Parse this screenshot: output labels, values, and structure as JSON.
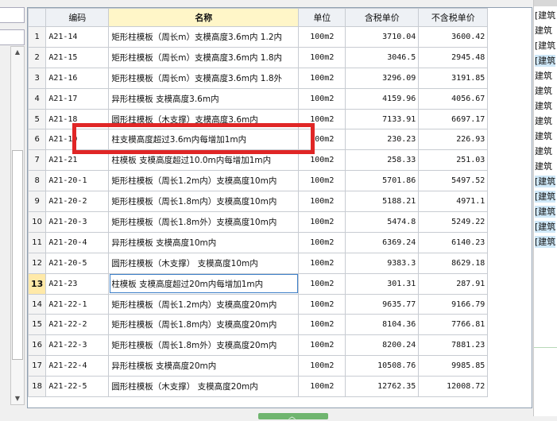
{
  "columns": {
    "index": "",
    "code": "编码",
    "name": "名称",
    "unit": "单位",
    "price_tax": "含税单价",
    "price_notax": "不含税单价"
  },
  "rows": [
    {
      "no": "1",
      "code": "A21-14",
      "name": "矩形柱模板（周长m）支模高度3.6m内 1.2内",
      "unit": "100m2",
      "tax": "3710.04",
      "notax": "3600.42"
    },
    {
      "no": "2",
      "code": "A21-15",
      "name": "矩形柱模板（周长m）支模高度3.6m内 1.8内",
      "unit": "100m2",
      "tax": "3046.5",
      "notax": "2945.48"
    },
    {
      "no": "3",
      "code": "A21-16",
      "name": "矩形柱模板（周长m）支模高度3.6m内 1.8外",
      "unit": "100m2",
      "tax": "3296.09",
      "notax": "3191.85"
    },
    {
      "no": "4",
      "code": "A21-17",
      "name": "异形柱模板 支模高度3.6m内",
      "unit": "100m2",
      "tax": "4159.96",
      "notax": "4056.67"
    },
    {
      "no": "5",
      "code": "A21-18",
      "name": "圆形柱模板（木支撑）支模高度3.6m内",
      "unit": "100m2",
      "tax": "7133.91",
      "notax": "6697.17"
    },
    {
      "no": "6",
      "code": "A21-19",
      "name": "柱支模高度超过3.6m内每增加1m内",
      "unit": "100m2",
      "tax": "230.23",
      "notax": "226.93"
    },
    {
      "no": "7",
      "code": "A21-21",
      "name": "柱模板 支模高度超过10.0m内每增加1m内",
      "unit": "100m2",
      "tax": "258.33",
      "notax": "251.03"
    },
    {
      "no": "8",
      "code": "A21-20-1",
      "name": "矩形柱模板（周长1.2m内）支模高度10m内",
      "unit": "100m2",
      "tax": "5701.86",
      "notax": "5497.52"
    },
    {
      "no": "9",
      "code": "A21-20-2",
      "name": "矩形柱模板（周长1.8m内）支模高度10m内",
      "unit": "100m2",
      "tax": "5188.21",
      "notax": "4971.1"
    },
    {
      "no": "10",
      "code": "A21-20-3",
      "name": "矩形柱模板（周长1.8m外）支模高度10m内",
      "unit": "100m2",
      "tax": "5474.8",
      "notax": "5249.22"
    },
    {
      "no": "11",
      "code": "A21-20-4",
      "name": "异形柱模板 支模高度10m内",
      "unit": "100m2",
      "tax": "6369.24",
      "notax": "6140.23"
    },
    {
      "no": "12",
      "code": "A21-20-5",
      "name": "圆形柱模板（木支撑） 支模高度10m内",
      "unit": "100m2",
      "tax": "9383.3",
      "notax": "8629.18"
    },
    {
      "no": "13",
      "code": "A21-23",
      "name": "柱模板 支模高度超过20m内每增加1m内",
      "unit": "100m2",
      "tax": "301.31",
      "notax": "287.91"
    },
    {
      "no": "14",
      "code": "A21-22-1",
      "name": "矩形柱模板（周长1.2m内）支模高度20m内",
      "unit": "100m2",
      "tax": "9635.77",
      "notax": "9166.79"
    },
    {
      "no": "15",
      "code": "A21-22-2",
      "name": "矩形柱模板（周长1.8m内）支模高度20m内",
      "unit": "100m2",
      "tax": "8104.36",
      "notax": "7766.81"
    },
    {
      "no": "16",
      "code": "A21-22-3",
      "name": "矩形柱模板（周长1.8m外）支模高度20m内",
      "unit": "100m2",
      "tax": "8200.24",
      "notax": "7881.23"
    },
    {
      "no": "17",
      "code": "A21-22-4",
      "name": "异形柱模板 支模高度20m内",
      "unit": "100m2",
      "tax": "10508.76",
      "notax": "9985.85"
    },
    {
      "no": "18",
      "code": "A21-22-5",
      "name": "圆形柱模板（木支撑） 支模高度20m内",
      "unit": "100m2",
      "tax": "12762.35",
      "notax": "12008.72"
    }
  ],
  "selected_row": "13",
  "right_labels": [
    {
      "text": "[建筑",
      "tag": false
    },
    {
      "text": "建筑",
      "tag": false
    },
    {
      "text": "[建筑",
      "tag": false
    },
    {
      "text": "[建筑",
      "tag": true
    },
    {
      "text": "建筑",
      "tag": false
    },
    {
      "text": "建筑",
      "tag": false
    },
    {
      "text": "建筑",
      "tag": false
    },
    {
      "text": "建筑",
      "tag": false
    },
    {
      "text": "建筑",
      "tag": false
    },
    {
      "text": "建筑",
      "tag": false
    },
    {
      "text": "建筑",
      "tag": false
    },
    {
      "text": "[建筑",
      "tag": true
    },
    {
      "text": "[建筑",
      "tag": true
    },
    {
      "text": "[建筑",
      "tag": true
    },
    {
      "text": "[建筑",
      "tag": true
    },
    {
      "text": "[建筑",
      "tag": true
    }
  ],
  "colors": {
    "highlight": "#e02626",
    "selection": "#3d7fc8",
    "name_header": "#fff6c8"
  }
}
